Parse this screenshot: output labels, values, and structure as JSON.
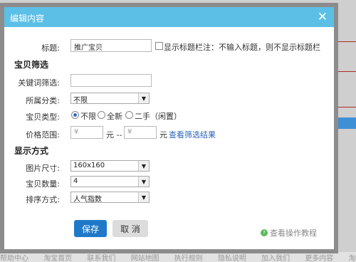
{
  "dialog": {
    "title": "编辑内容",
    "close_label": "✕"
  },
  "form": {
    "title_label": "标题:",
    "title_value": "推广宝贝",
    "show_title_label": "显示标题栏注：不输入标题，则不显示标题栏",
    "section_filter": "宝贝筛选",
    "keyword_label": "关键词筛选:",
    "keyword_value": "",
    "category_label": "所属分类:",
    "category_value": "不限",
    "type_label": "宝贝类型:",
    "type_options": [
      "不限",
      "全新",
      "二手（闲置）"
    ],
    "type_selected": "不限",
    "price_label": "价格范围:",
    "price_min_placeholder": "¥",
    "price_max_placeholder": "¥",
    "price_sep": "元 --",
    "price_unit": "元",
    "view_results_link": "查看筛选结果",
    "section_display": "显示方式",
    "image_size_label": "图片尺寸:",
    "image_size_value": "160x160",
    "count_label": "宝贝数量:",
    "count_value": "4",
    "sort_label": "排序方式:",
    "sort_value": "人气指数"
  },
  "buttons": {
    "save": "保存",
    "cancel": "取 消"
  },
  "help": {
    "label": "查看操作教程"
  },
  "background": {
    "footer_items": [
      "帮助中心",
      "淘宝首页",
      "联系我们",
      "网站地图",
      "执行规则",
      "隐私说明",
      "加入我们",
      "更多内容",
      "淘宝"
    ]
  }
}
